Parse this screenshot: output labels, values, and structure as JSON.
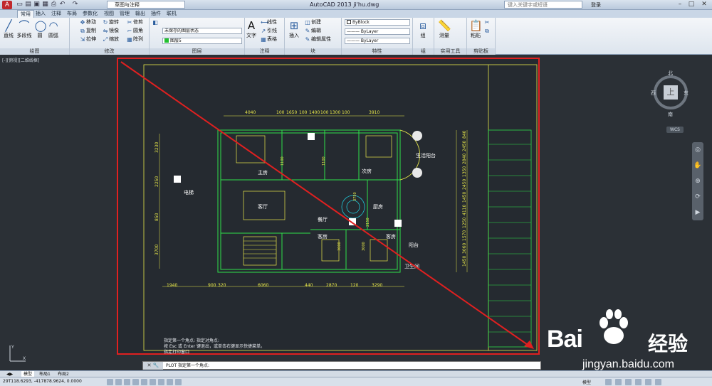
{
  "titlebar": {
    "workspace": "草图与注释",
    "title": "AutoCAD 2013    ji'hu.dwg",
    "search_placeholder": "键入关键字或短语",
    "login": "登录"
  },
  "tabs": [
    "常用",
    "插入",
    "注释",
    "布局",
    "参数化",
    "视图",
    "管理",
    "输出",
    "插件",
    "联机"
  ],
  "ribbon": {
    "draw": {
      "title": "绘图",
      "line": "直线",
      "polyline": "多段线",
      "circle": "圆",
      "arc": "圆弧"
    },
    "modify": {
      "title": "修改",
      "move": "移动",
      "rotate": "旋转",
      "trim": "修剪",
      "copy": "复制",
      "mirror": "镜像",
      "fillet": "圆角",
      "stretch": "拉伸",
      "scale": "缩放",
      "array": "阵列"
    },
    "layers": {
      "title": "图层",
      "state": "未保存的图层状态",
      "current": "图层5"
    },
    "annotation": {
      "title": "注释",
      "text": "文字",
      "linear": "线性",
      "leader": "引线",
      "table": "表格"
    },
    "block": {
      "title": "块",
      "insert": "插入",
      "create": "创建",
      "edit": "编辑",
      "edit_attr": "编辑属性"
    },
    "properties": {
      "title": "特性",
      "color": "ByBlock",
      "linetype": "ByLayer",
      "lineweight": "ByLayer"
    },
    "groups": {
      "title": "组",
      "group": "组"
    },
    "utilities": {
      "title": "实用工具",
      "measure": "测量"
    },
    "clipboard": {
      "title": "剪贴板",
      "paste": "粘贴"
    }
  },
  "viewport_label": "[-][俯视][二维线框]",
  "drawing": {
    "top_dims": [
      "4040",
      "100",
      "1650",
      "100",
      "1400",
      "100",
      "1300",
      "100",
      "3910"
    ],
    "bottom_dims": [
      "1940",
      "900",
      "320",
      "6060",
      "440",
      "2870",
      "120",
      "3290"
    ],
    "left_dims": [
      "3230",
      "2250",
      "850",
      "3700"
    ],
    "right_dims": [
      "840",
      "2450",
      "2840",
      "1350",
      "2450",
      "1450",
      "4110",
      "1250",
      "1570",
      "3060",
      "1450"
    ],
    "rooms": [
      "主房",
      "次房",
      "生活阳台",
      "客厅",
      "餐厅",
      "厨房",
      "客房",
      "客房",
      "阳台",
      "卫生间",
      "电梯"
    ],
    "inner_dims": [
      "1100",
      "1100",
      "3750",
      "2150",
      "3000",
      "3000"
    ]
  },
  "viewcube": {
    "top": "上",
    "n": "北",
    "s": "南",
    "e": "东",
    "w": "西",
    "wcs": "WCS"
  },
  "command": {
    "history": [
      "指定第一个角点: 指定对角点:",
      "按 Esc 或 Enter 键退出，或单击右键显示快捷菜单。",
      "指定打印窗口"
    ],
    "prompt": "PLOT 指定第一个角点:"
  },
  "layout_tabs": [
    "模型",
    "布局1",
    "布局2"
  ],
  "status": {
    "coords": "29T118.6293, -417878.9624, 0.0000",
    "model": "模型"
  },
  "watermark": {
    "brand": "Bai",
    "brand2": "经验",
    "url": "jingyan.baidu.com"
  },
  "colors": {
    "accent": "#e02020",
    "drawing_green": "#2fe04a",
    "drawing_yellow": "#e8e84a",
    "drawing_cyan": "#20c8d8"
  }
}
